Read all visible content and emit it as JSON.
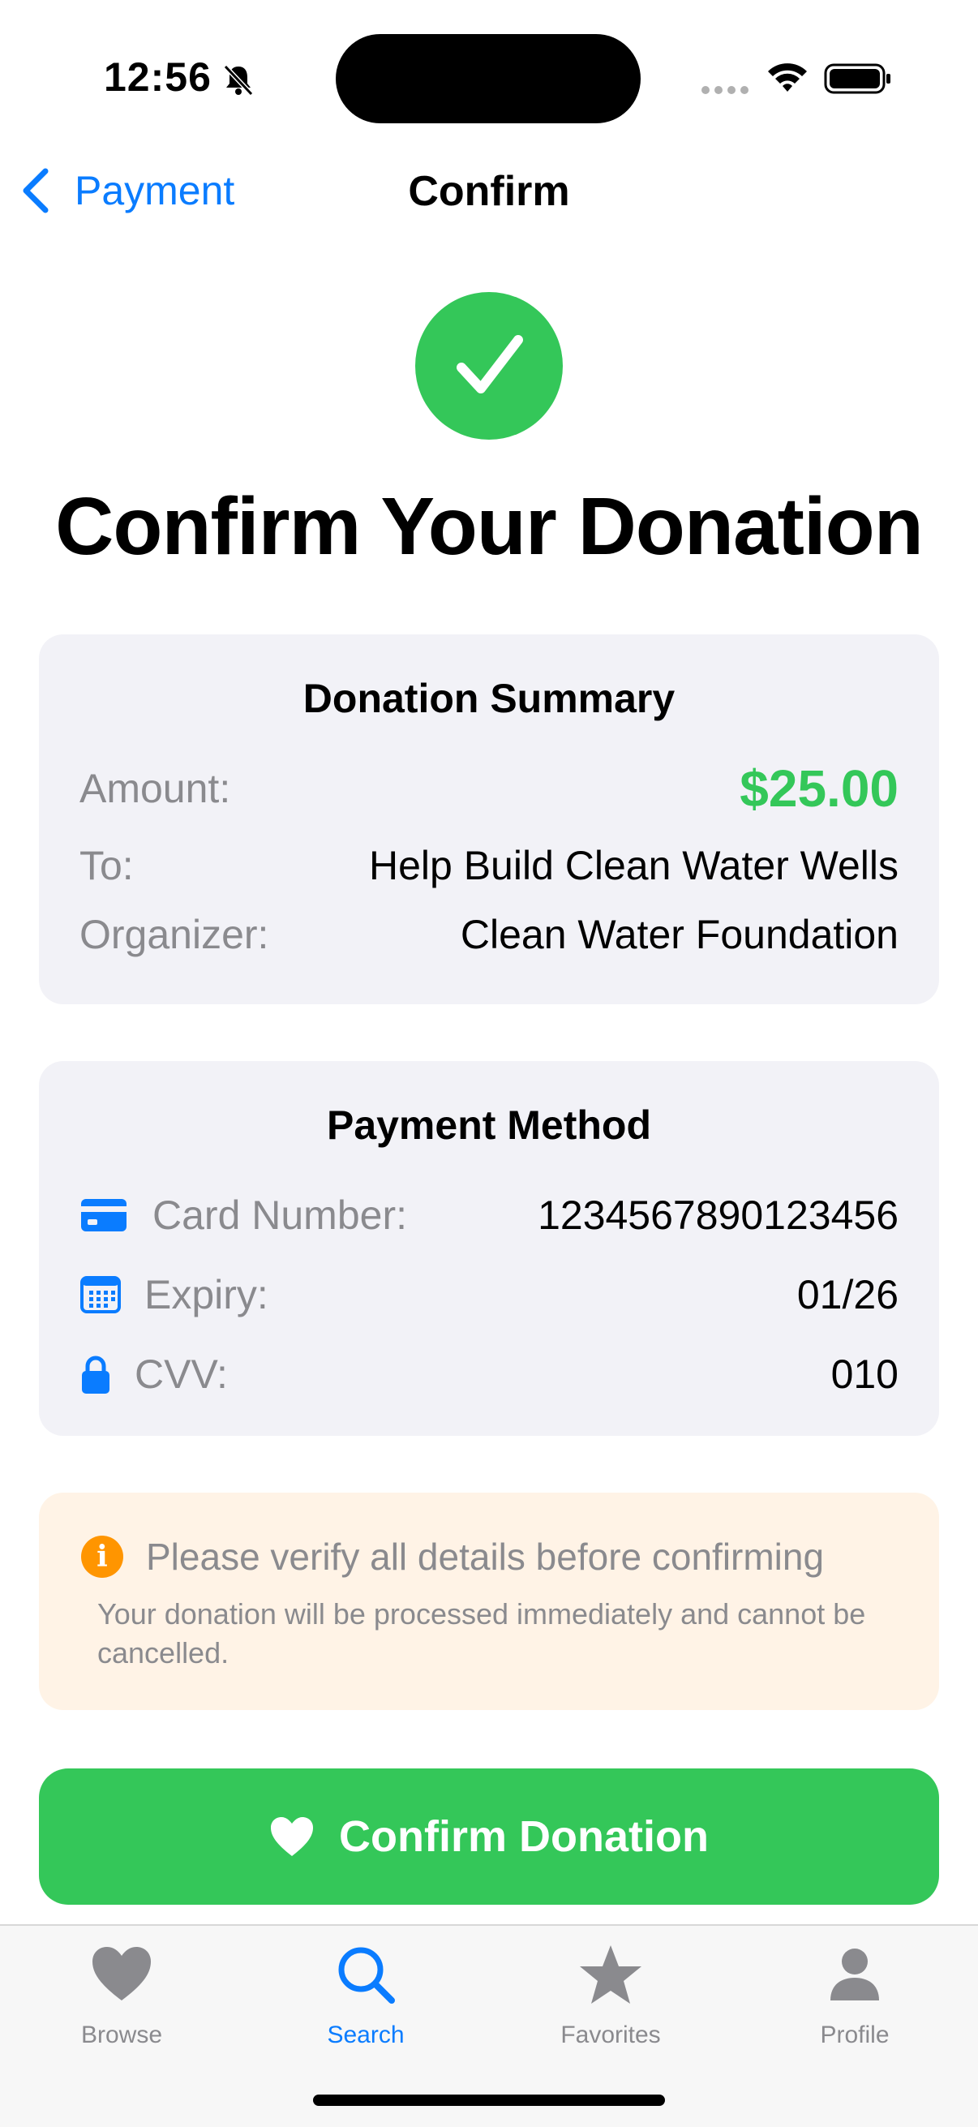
{
  "status_bar": {
    "time": "12:56"
  },
  "nav": {
    "back_label": "Payment",
    "title": "Confirm"
  },
  "headline": "Confirm Your Donation",
  "summary": {
    "title": "Donation Summary",
    "amount_label": "Amount:",
    "amount_value": "$25.00",
    "to_label": "To:",
    "to_value": "Help Build Clean Water Wells",
    "organizer_label": "Organizer:",
    "organizer_value": "Clean Water Foundation"
  },
  "payment": {
    "title": "Payment Method",
    "card_label": "Card Number:",
    "card_value": "1234567890123456",
    "expiry_label": "Expiry:",
    "expiry_value": "01/26",
    "cvv_label": "CVV:",
    "cvv_value": "010"
  },
  "warning": {
    "title": "Please verify all details before confirming",
    "body": "Your donation will be processed immediately and cannot be cancelled."
  },
  "confirm_button": {
    "label": "Confirm Donation"
  },
  "tabs": [
    {
      "label": "Browse",
      "icon": "heart-icon",
      "active": false
    },
    {
      "label": "Search",
      "icon": "search-icon",
      "active": true
    },
    {
      "label": "Favorites",
      "icon": "star-icon",
      "active": false
    },
    {
      "label": "Profile",
      "icon": "person-icon",
      "active": false
    }
  ],
  "colors": {
    "accent": "#0a7cff",
    "success": "#34c759",
    "warning": "#ff9500",
    "card_bg": "#f2f2f7",
    "warning_bg": "#fff3e6"
  }
}
